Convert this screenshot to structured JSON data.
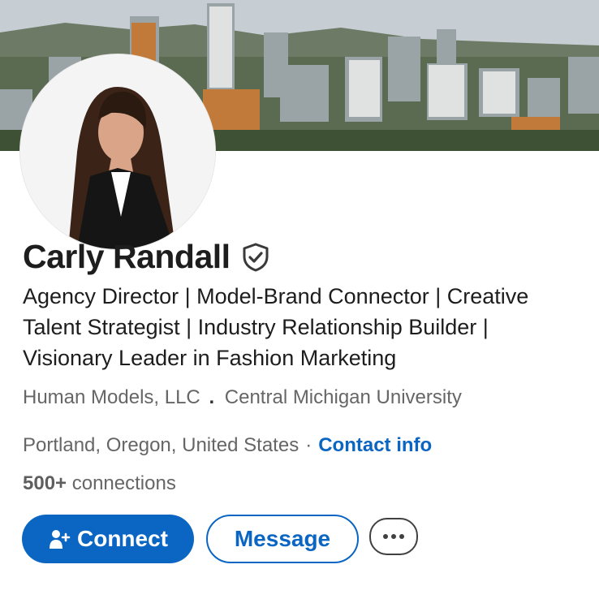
{
  "profile": {
    "name": "Carly Randall",
    "headline": "Agency Director | Model-Brand Connector | Creative Talent Strategist | Industry Relationship Builder | Visionary Leader in Fashion Marketing",
    "company": "Human Models, LLC",
    "separator": ".",
    "school": "Central Michigan University",
    "location": "Portland, Oregon, United States",
    "dot": "·",
    "contact_info_label": "Contact info",
    "connections_count": "500+",
    "connections_label": "connections"
  },
  "actions": {
    "connect_label": "Connect",
    "message_label": "Message",
    "more_icon": "ellipsis-icon"
  },
  "icons": {
    "verified": "verified-shield-icon",
    "connect": "add-person-icon"
  },
  "colors": {
    "primary": "#0a66c2",
    "text": "#1d1d1d",
    "muted": "#666666"
  }
}
